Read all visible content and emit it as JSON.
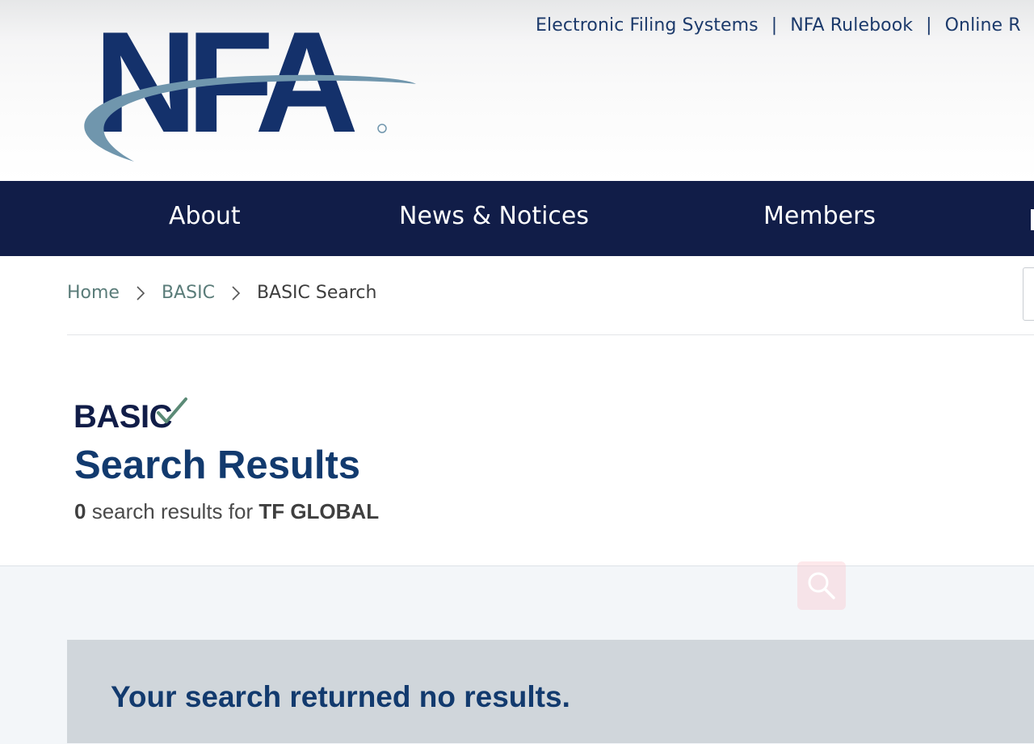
{
  "header": {
    "logo_text": "NFA",
    "utility_links": [
      "Electronic Filing Systems",
      "NFA Rulebook",
      "Online R"
    ],
    "separator": "|"
  },
  "main_nav": {
    "items": [
      "About",
      "News & Notices",
      "Members"
    ]
  },
  "breadcrumb": {
    "home": "Home",
    "basic": "BASIC",
    "current": "BASIC Search"
  },
  "page": {
    "brand_logo": "BASIC",
    "title": "Search Results",
    "result_count": "0",
    "result_text": "search results for",
    "query": "TF GLOBAL"
  },
  "no_results": {
    "message": "Your search returned no results."
  },
  "icons": {
    "chevron": "chevron-right-icon",
    "search": "search-icon",
    "check": "checkmark-icon"
  },
  "colors": {
    "nav_bg": "#111d48",
    "title": "#123a6e",
    "breadcrumb_link": "#5a7c79",
    "no_results_bg": "#d0d6db"
  }
}
